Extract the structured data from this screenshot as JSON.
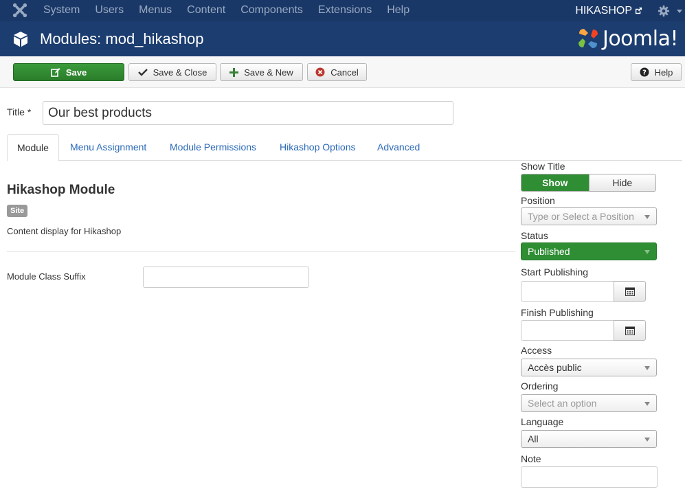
{
  "navbar": {
    "menu": [
      "System",
      "Users",
      "Menus",
      "Content",
      "Components",
      "Extensions",
      "Help"
    ],
    "site_link": "HIKASHOP"
  },
  "header": {
    "title": "Modules: mod_hikashop",
    "brand": "Joomla!"
  },
  "toolbar": {
    "save": "Save",
    "save_close": "Save & Close",
    "save_new": "Save & New",
    "cancel": "Cancel",
    "help": "Help"
  },
  "form": {
    "title_label": "Title *",
    "title_value": "Our best products"
  },
  "tabs": [
    "Module",
    "Menu Assignment",
    "Module Permissions",
    "Hikashop Options",
    "Advanced"
  ],
  "main": {
    "heading": "Hikashop Module",
    "badge": "Site",
    "description": "Content display for Hikashop",
    "class_suffix_label": "Module Class Suffix",
    "class_suffix_value": ""
  },
  "sidebar": {
    "show_title_label": "Show Title",
    "show_option": "Show",
    "hide_option": "Hide",
    "position_label": "Position",
    "position_placeholder": "Type or Select a Position",
    "status_label": "Status",
    "status_value": "Published",
    "start_publishing_label": "Start Publishing",
    "finish_publishing_label": "Finish Publishing",
    "access_label": "Access",
    "access_value": "Accès public",
    "ordering_label": "Ordering",
    "ordering_placeholder": "Select an option",
    "language_label": "Language",
    "language_value": "All",
    "note_label": "Note"
  },
  "colors": {
    "navbar_bg": "#1a3867",
    "header_bg": "#1c3d70",
    "success_green": "#2f8d34",
    "link_blue": "#2a69b8"
  }
}
